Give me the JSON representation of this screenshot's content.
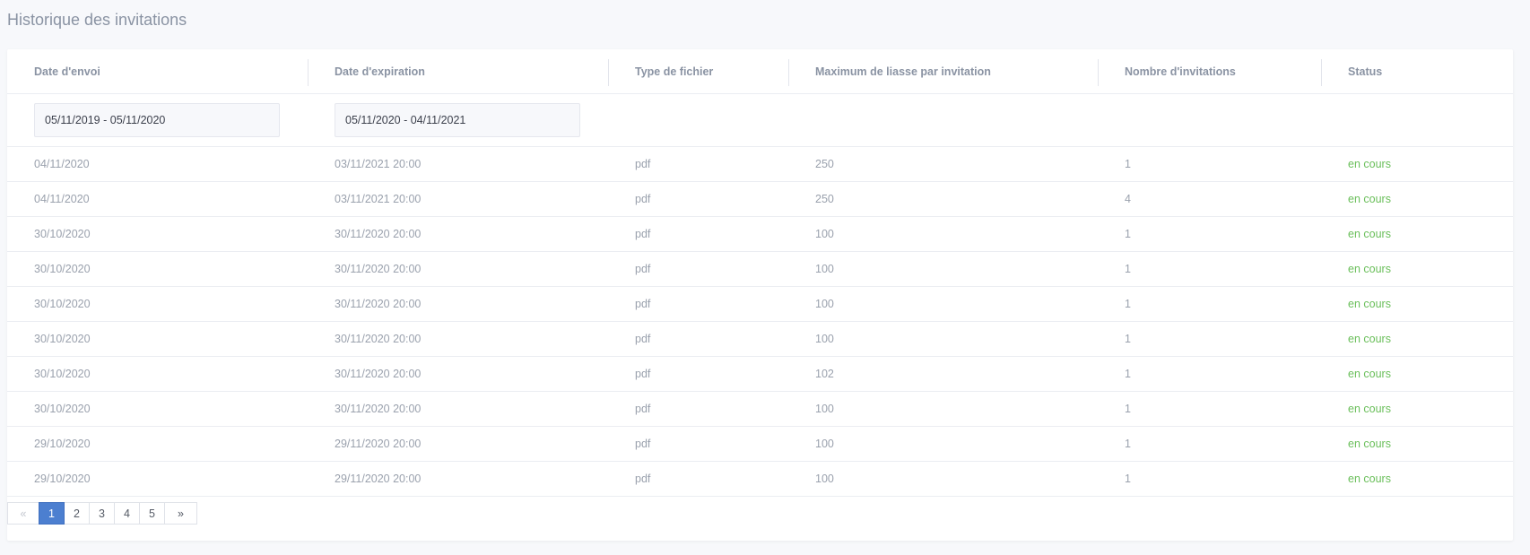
{
  "page": {
    "title": "Historique des invitations"
  },
  "table": {
    "headers": [
      "Date d'envoi",
      "Date d'expiration",
      "Type de fichier",
      "Maximum de liasse par invitation",
      "Nombre d'invitations",
      "Status"
    ],
    "filters": {
      "sent_range": "05/11/2019 - 05/11/2020",
      "expiry_range": "05/11/2020 - 04/11/2021"
    },
    "rows": [
      [
        "04/11/2020",
        "03/11/2021 20:00",
        "pdf",
        "250",
        "1",
        "en cours"
      ],
      [
        "04/11/2020",
        "03/11/2021 20:00",
        "pdf",
        "250",
        "4",
        "en cours"
      ],
      [
        "30/10/2020",
        "30/11/2020 20:00",
        "pdf",
        "100",
        "1",
        "en cours"
      ],
      [
        "30/10/2020",
        "30/11/2020 20:00",
        "pdf",
        "100",
        "1",
        "en cours"
      ],
      [
        "30/10/2020",
        "30/11/2020 20:00",
        "pdf",
        "100",
        "1",
        "en cours"
      ],
      [
        "30/10/2020",
        "30/11/2020 20:00",
        "pdf",
        "100",
        "1",
        "en cours"
      ],
      [
        "30/10/2020",
        "30/11/2020 20:00",
        "pdf",
        "102",
        "1",
        "en cours"
      ],
      [
        "30/10/2020",
        "30/11/2020 20:00",
        "pdf",
        "100",
        "1",
        "en cours"
      ],
      [
        "29/10/2020",
        "29/11/2020 20:00",
        "pdf",
        "100",
        "1",
        "en cours"
      ],
      [
        "29/10/2020",
        "29/11/2020 20:00",
        "pdf",
        "100",
        "1",
        "en cours"
      ]
    ]
  },
  "pagination": {
    "prev_label": "«",
    "next_label": "»",
    "pages": [
      "1",
      "2",
      "3",
      "4",
      "5"
    ],
    "active_page": "1"
  },
  "colors": {
    "status_active": "#6abf5a",
    "pagination_active": "#4c7fd0"
  }
}
